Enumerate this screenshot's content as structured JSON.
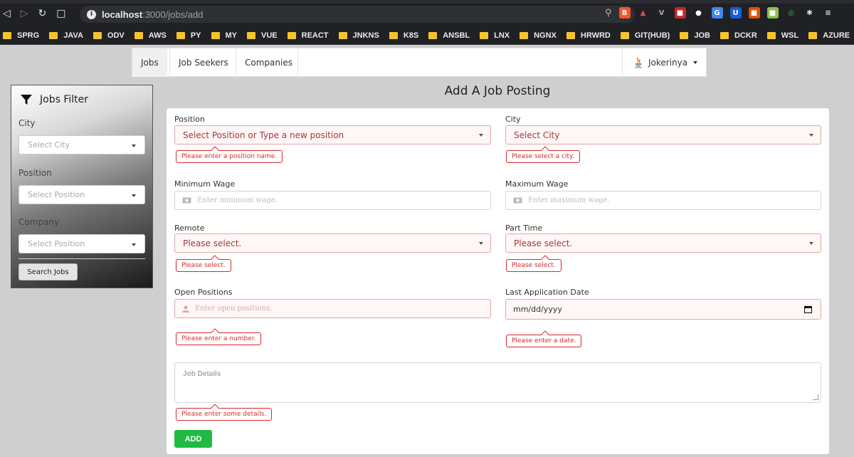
{
  "browser": {
    "url_host": "localhost",
    "url_path": ":3000/jobs/add",
    "bookmarks": [
      "SPRG",
      "JAVA",
      "ODV",
      "AWS",
      "PY",
      "MY",
      "VUE",
      "REACT",
      "JNKNS",
      "K8S",
      "ANSBL",
      "LNX",
      "NGNX",
      "HRWRD",
      "GIT(HUB)",
      "JOB",
      "DCKR",
      "WSL",
      "AZURE"
    ]
  },
  "navbar": {
    "tabs": [
      "Jobs",
      "Job Seekers",
      "Companies"
    ],
    "user": "Jokerinya"
  },
  "filter": {
    "title": "Jobs Filter",
    "city_label": "City",
    "city_placeholder": "Select City",
    "position_label": "Position",
    "position_placeholder": "Select Position",
    "company_label": "Company",
    "company_placeholder": "Select Position",
    "search_button": "Search Jobs"
  },
  "form": {
    "title": "Add A Job Posting",
    "position_label": "Position",
    "position_placeholder": "Select Position or Type a new position",
    "position_error": "Please enter a position name.",
    "city_label": "City",
    "city_placeholder": "Select City",
    "city_error": "Please select a city.",
    "min_wage_label": "Minimum Wage",
    "min_wage_placeholder": "Enter minimum wage.",
    "max_wage_label": "Maximum Wage",
    "max_wage_placeholder": "Enter maximum wage.",
    "remote_label": "Remote",
    "remote_placeholder": "Please select.",
    "remote_error": "Please select.",
    "parttime_label": "Part Time",
    "parttime_placeholder": "Please select.",
    "parttime_error": "Please select.",
    "open_positions_label": "Open Positions",
    "open_positions_placeholder": "Enter open positions.",
    "open_positions_error": "Please enter a number.",
    "last_date_label": "Last Application Date",
    "last_date_value": "mm/dd/yyyy",
    "last_date_error": "Please enter a date.",
    "details_placeholder": "Job Details",
    "details_error": "Please enter some details.",
    "add_button": "ADD"
  }
}
